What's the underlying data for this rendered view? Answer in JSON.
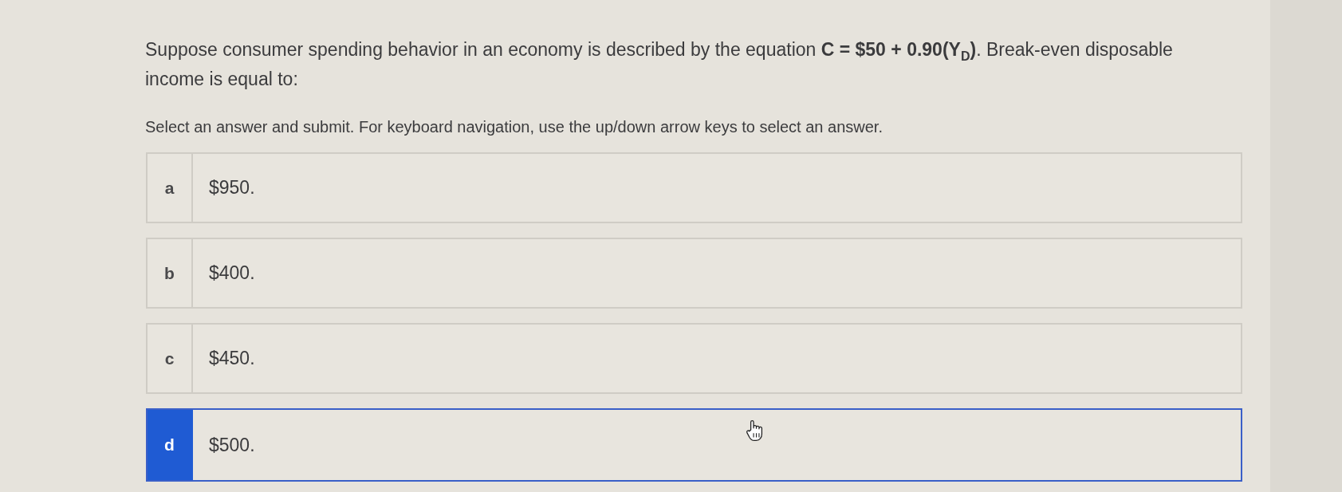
{
  "question": {
    "text": "Suppose consumer spending behavior in an economy is described by the equation **C = $50 + 0.90(Y**$_{D}$**)**. Break-even disposable income is equal to:"
  },
  "instructions": "Select an answer and submit. For keyboard navigation, use the up/down arrow keys to select an answer.",
  "options": [
    {
      "letter": "a",
      "text": "$950.",
      "selected": false
    },
    {
      "letter": "b",
      "text": "$400.",
      "selected": false
    },
    {
      "letter": "c",
      "text": "$450.",
      "selected": false
    },
    {
      "letter": "d",
      "text": "$500.",
      "selected": true
    }
  ]
}
